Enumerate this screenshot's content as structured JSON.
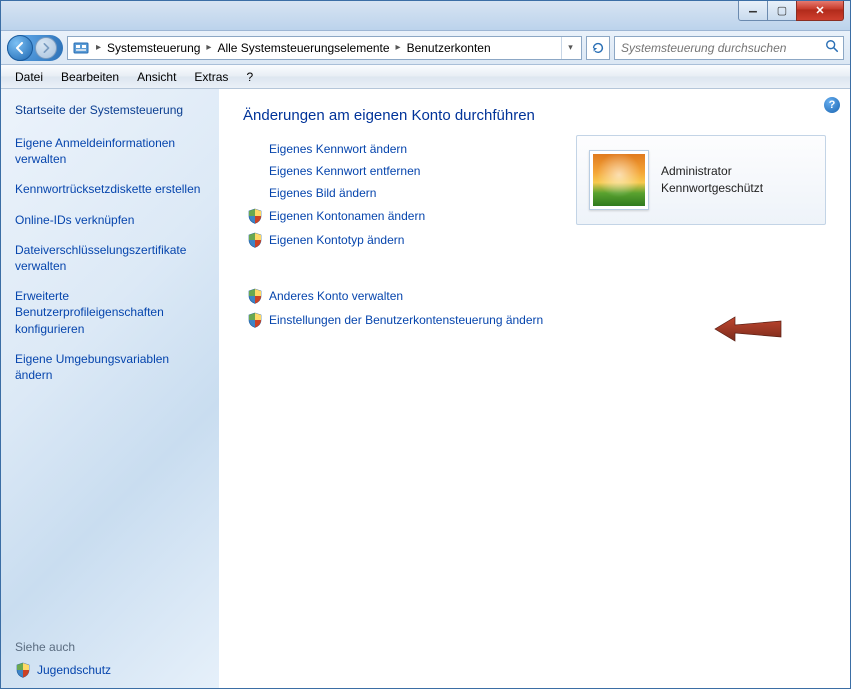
{
  "titlebar": {},
  "nav": {
    "breadcrumb": [
      "Systemsteuerung",
      "Alle Systemsteuerungselemente",
      "Benutzerkonten"
    ],
    "search_placeholder": "Systemsteuerung durchsuchen"
  },
  "menubar": [
    "Datei",
    "Bearbeiten",
    "Ansicht",
    "Extras",
    "?"
  ],
  "sidebar": {
    "home": "Startseite der Systemsteuerung",
    "tasks": [
      "Eigene Anmeldeinformationen verwalten",
      "Kennwortrücksetzdiskette erstellen",
      "Online-IDs verknüpfen",
      "Dateiverschlüsselungs­zertifikate verwalten",
      "Erweiterte Benutzerprofileigenschaften konfigurieren",
      "Eigene Umgebungsvariablen ändern"
    ],
    "seealso_head": "Siehe auch",
    "seealso_item": "Jugendschutz"
  },
  "content": {
    "heading": "Änderungen am eigenen Konto durchführen",
    "actions_plain": [
      "Eigenes Kennwort ändern",
      "Eigenes Kennwort entfernen",
      "Eigenes Bild ändern"
    ],
    "actions_shield": [
      "Eigenen Kontonamen ändern",
      "Eigenen Kontotyp ändern"
    ],
    "actions_shield2": [
      "Anderes Konto verwalten",
      "Einstellungen der Benutzerkontensteuerung ändern"
    ]
  },
  "account": {
    "name": "Administrator",
    "status": "Kennwortgeschützt"
  }
}
